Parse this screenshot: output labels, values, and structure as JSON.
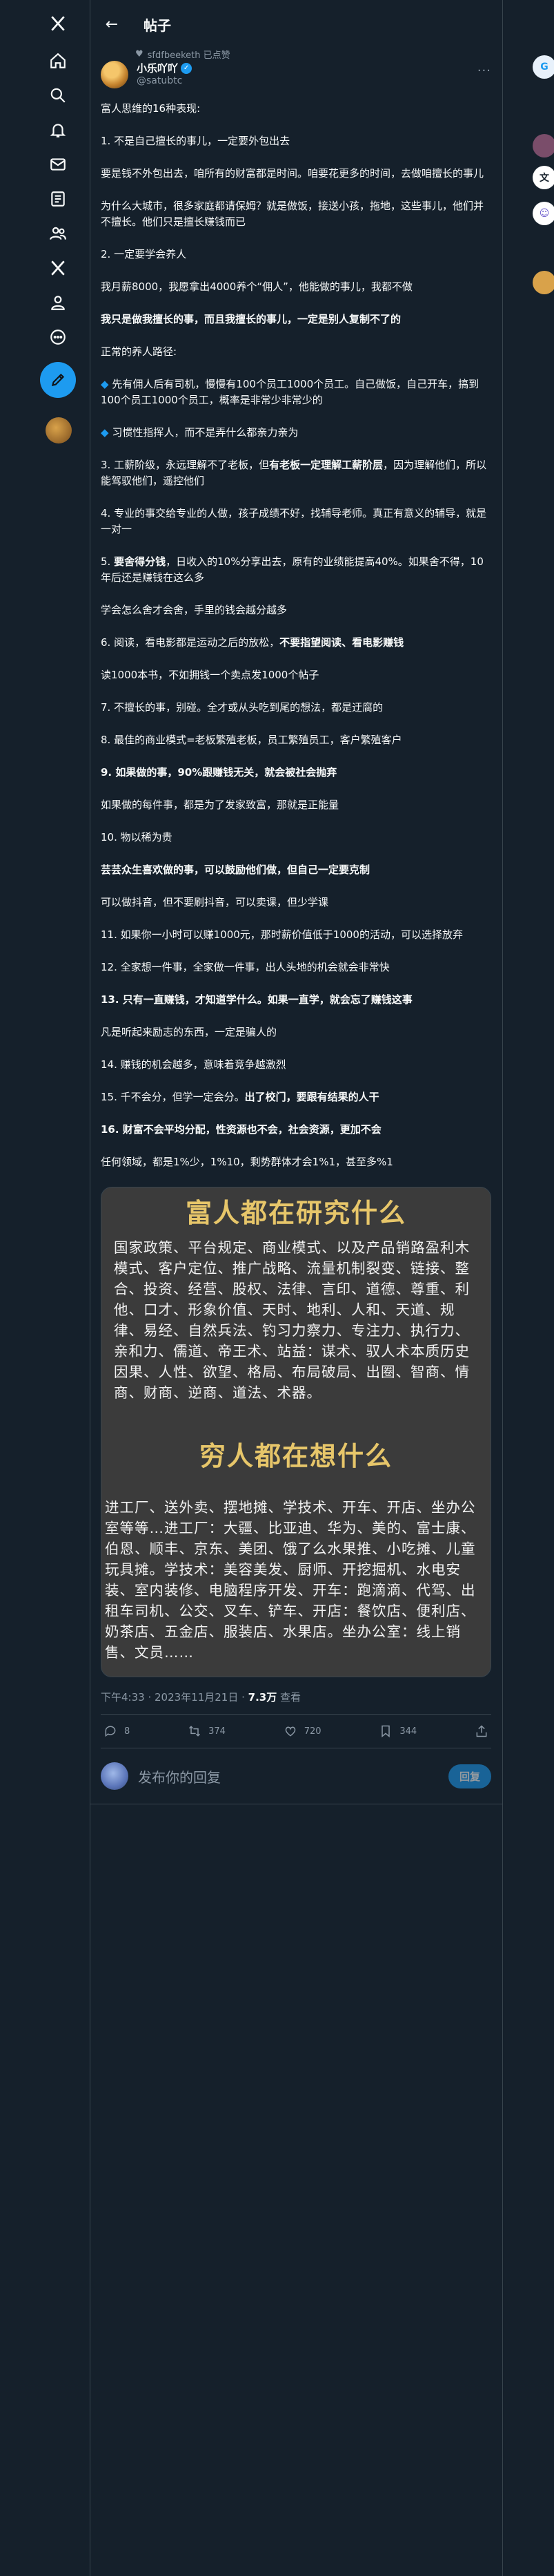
{
  "nav": {
    "icons": [
      "x-logo-icon",
      "home-icon",
      "search-icon",
      "notifications-icon",
      "messages-icon",
      "bookmarks-icon",
      "communities-icon",
      "premium-icon",
      "profile-icon",
      "more-icon",
      "post-icon",
      "account-avatar"
    ]
  },
  "header": {
    "title": "帖子"
  },
  "social_context": "sfdfbeeketh 已点赞",
  "author": {
    "name": "小乐吖吖",
    "handle": "@satubtc",
    "verified_glyph": "✓"
  },
  "tweet": {
    "paragraphs": [
      {
        "t": "富人思维的16种表现:"
      },
      {
        "t": "1. 不是自己擅长的事儿，一定要外包出去"
      },
      {
        "t": "要是钱不外包出去，咱所有的财富都是时间。咱要花更多的时间，去做咱擅长的事儿"
      },
      {
        "t": "为什么大城市，很多家庭都请保姆？就是做饭，接送小孩，拖地，这些事儿，他们并不擅长。他们只是擅长赚钱而已"
      },
      {
        "t": "2. 一定要学会养人"
      },
      {
        "t": "我月薪8000，我愿拿出4000养个“佣人”，他能做的事儿，我都不做"
      },
      {
        "t": "我只是做我擅长的事，而且我擅长的事儿，一定是别人复制不了的",
        "bold": true
      },
      {
        "t": "正常的养人路径:"
      },
      {
        "t": "先有佣人后有司机，慢慢有100个员工1000个员工。自己做饭，自己开车，搞到100个员工1000个员工，概率是非常少非常少的",
        "diamond": true
      },
      {
        "t": "习惯性指挥人，而不是弄什么都亲力亲为",
        "diamond": true
      },
      {
        "t": "3. 工薪阶级，永远理解不了老板，但有老板一定理解工薪阶层，因为理解他们，所以能驾驭他们，遥控他们",
        "boldpart": "有老板一定理解工薪阶层"
      },
      {
        "t": "4. 专业的事交给专业的人做，孩子成绩不好，找辅导老师。真正有意义的辅导，就是一对一"
      },
      {
        "t": "5. 要舍得分钱，日收入的10%分享出去，原有的业绩能提高40%。如果舍不得，10年后还是赚钱在这么多",
        "boldpart": "要舍得分钱"
      },
      {
        "t": "学会怎么舍才会舍，手里的钱会越分越多"
      },
      {
        "t": "6. 阅读，看电影都是运动之后的放松，不要指望阅读、看电影赚钱",
        "boldpart": "不要指望阅读、看电影赚钱"
      },
      {
        "t": "读1000本书，不如拥钱一个卖点发1000个帖子"
      },
      {
        "t": "7. 不擅长的事，别碰。全才或从头吃到尾的想法，都是迂腐的"
      },
      {
        "t": "8. 最佳的商业模式=老板繁殖老板，员工繁殖员工，客户繁殖客户"
      },
      {
        "t": "9. 如果做的事，90%跟赚钱无关，就会被社会抛弃",
        "bold": true
      },
      {
        "t": "如果做的每件事，都是为了发家致富，那就是正能量"
      },
      {
        "t": "10. 物以稀为贵"
      },
      {
        "t": "芸芸众生喜欢做的事，可以鼓励他们做，但自己一定要克制",
        "bold": true
      },
      {
        "t": "可以做抖音，但不要刷抖音，可以卖课，但少学课"
      },
      {
        "t": "11. 如果你一小时可以赚1000元，那时薪价值低于1000的活动，可以选择放弃"
      },
      {
        "t": "12. 全家想一件事，全家做一件事，出人头地的机会就会非常快"
      },
      {
        "t": "13. 只有一直赚钱，才知道学什么。如果一直学，就会忘了赚钱这事",
        "bold": true
      },
      {
        "t": "凡是听起来励志的东西，一定是骗人的"
      },
      {
        "t": "14. 赚钱的机会越多，意味着竞争越激烈"
      },
      {
        "t": "15. 千不会分，但学一定会分。出了校门，要跟有结果的人干",
        "boldpart": "出了校门，要跟有结果的人干"
      },
      {
        "t": "16. 财富不会平均分配，性资源也不会，社会资源，更加不会",
        "bold": true
      },
      {
        "t": "任何领域，都是1%少，1%10，剩势群体才会1%1，甚至多%1"
      }
    ]
  },
  "image": {
    "rich_title": "富人都在研究什么",
    "rich_text": "国家政策、平台规定、商业模式、以及产品销路盈利木模式、客户定位、推广战略、流量机制裂变、链接、整合、投资、经营、股权、法律、言印、道德、尊重、利他、口才、形象价值、天时、地利、人和、天道、规律、易经、自然兵法、钓习力察力、专注力、执行力、亲和力、儒道、帝王术、站益：谋术、驭人术本质历史因果、人性、欲望、格局、布局破局、出圈、智商、情商、财商、逆商、道法、术器。",
    "poor_title": "穷人都在想什么",
    "poor_text": "进工厂、送外卖、摆地摊、学技术、开车、开店、坐办公室等等…进工厂：大疆、比亚迪、华为、美的、富士康、伯恩、顺丰、京东、美团、饿了么水果推、小吃摊、儿童玩具摊。学技术：美容美发、厨师、开挖掘机、水电安装、室内装修、电脑程序开发、开车：跑滴滴、代驾、出租车司机、公交、叉车、铲车、开店：餐饮店、便利店、奶茶店、五金店、服装店、水果店。坐办公室：线上销售、文员……"
  },
  "meta": {
    "time": "下午4:33 · 2023年11月21日",
    "views": "7.3万",
    "views_label": "查看"
  },
  "actions": {
    "replies": "8",
    "reposts": "374",
    "likes": "720",
    "bookmarks": "344"
  },
  "reply": {
    "placeholder": "发布你的回复",
    "button": "回复"
  },
  "colors": {
    "accent": "#1d9bf0",
    "background": "#15202b",
    "image_title": "#e7c66a"
  }
}
